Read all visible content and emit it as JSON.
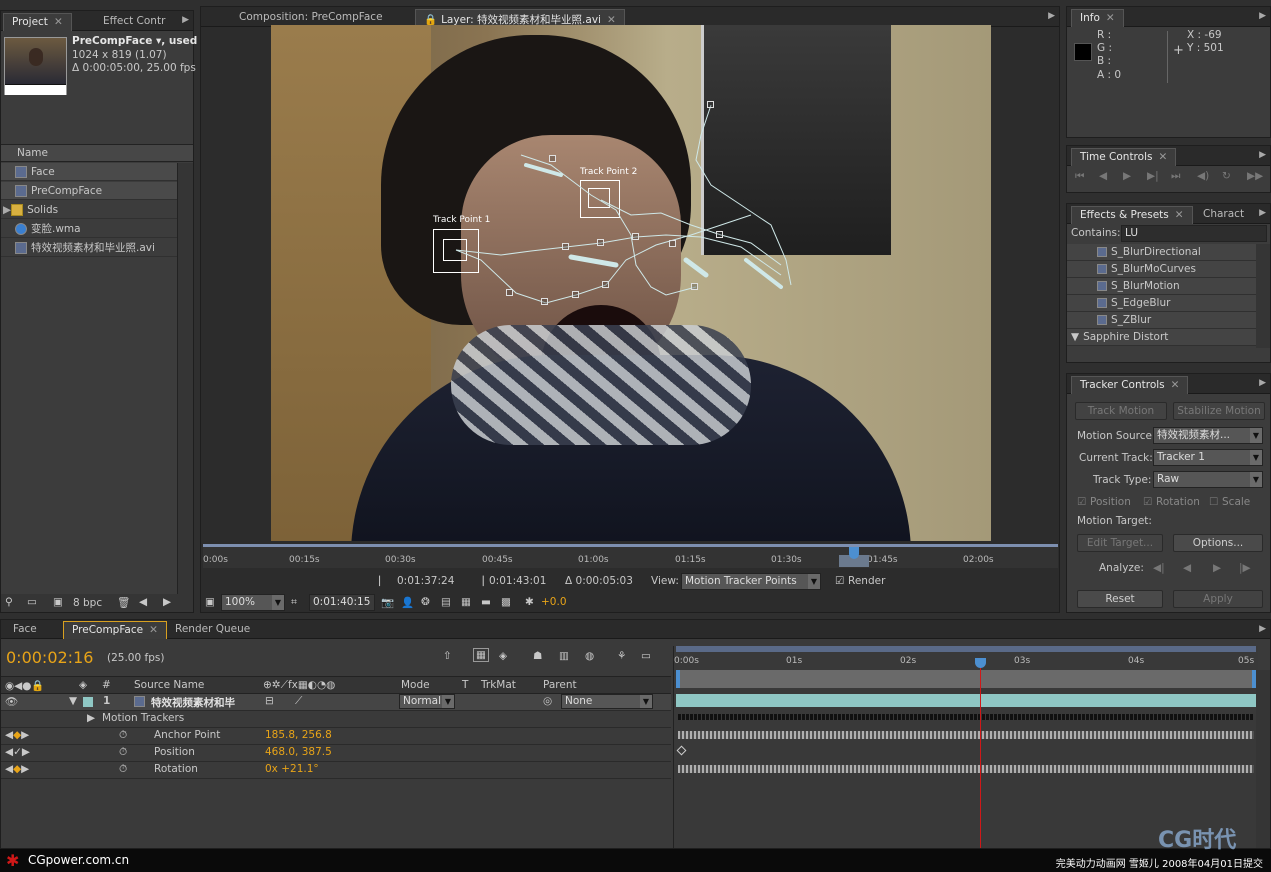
{
  "project": {
    "tab_project": "Project",
    "tab_effect": "Effect Contr",
    "comp_name": "PreCompFace ▾, used",
    "comp_size": "1024 x 819 (1.07)",
    "comp_dur": "Δ 0:00:05:00, 25.00 fps",
    "name_header": "Name",
    "items": [
      {
        "label": "Face"
      },
      {
        "label": "PreCompFace"
      },
      {
        "label": "Solids"
      },
      {
        "label": "变脸.wma"
      },
      {
        "label": "特效视频素材和毕业照.avi"
      }
    ],
    "bpc": "8 bpc"
  },
  "viewer": {
    "tab_comp": "Composition: PreCompFace",
    "tab_layer": "Layer: 特效视频素材和毕业照.avi",
    "track_point_1": "Track Point 1",
    "track_point_2": "Track Point 2",
    "ruler": [
      "0:00s",
      "00:15s",
      "00:30s",
      "00:45s",
      "01:00s",
      "01:15s",
      "01:30s",
      "01:45s",
      "02:00s"
    ],
    "in_time": "0:01:37:24",
    "out_time": "0:01:43:01",
    "dur_time": "Δ 0:00:05:03",
    "view_label": "View:",
    "view_value": "Motion Tracker Points",
    "render_label": "Render",
    "zoom": "100%",
    "current_time": "0:01:40:15",
    "exposure": "+0.0"
  },
  "info": {
    "tab": "Info",
    "r": "R :",
    "g": "G :",
    "b": "B :",
    "a": "A : 0",
    "x": "X : -69",
    "y": "Y : 501"
  },
  "time_controls": {
    "tab": "Time Controls"
  },
  "effects": {
    "tab": "Effects & Presets",
    "tab2": "Charact",
    "contains_label": "Contains:",
    "contains_value": "LU",
    "items": [
      "S_BlurDirectional",
      "S_BlurMoCurves",
      "S_BlurMotion",
      "S_EdgeBlur",
      "S_ZBlur"
    ],
    "group": "Sapphire Distort"
  },
  "tracker": {
    "tab": "Tracker Controls",
    "track_motion": "Track Motion",
    "stabilize_motion": "Stabilize Motion",
    "motion_source_label": "Motion Source:",
    "motion_source": "特效视频素材...",
    "current_track_label": "Current Track:",
    "current_track": "Tracker 1",
    "track_type_label": "Track Type:",
    "track_type": "Raw",
    "position": "Position",
    "rotation": "Rotation",
    "scale": "Scale",
    "motion_target_label": "Motion Target:",
    "edit_target": "Edit Target...",
    "options": "Options...",
    "analyze_label": "Analyze:",
    "reset": "Reset",
    "apply": "Apply"
  },
  "timeline": {
    "tab_face": "Face",
    "tab_precomp": "PreCompFace",
    "tab_render": "Render Queue",
    "time": "0:00:02:16",
    "fps": "(25.00 fps)",
    "col_num": "#",
    "col_source": "Source Name",
    "col_mode": "Mode",
    "col_t": "T",
    "col_trkmat": "TrkMat",
    "col_parent": "Parent",
    "layer_num": "1",
    "layer_name": "特效视频素材和毕",
    "layer_mode": "Normal",
    "layer_parent": "None",
    "motion_trackers": "Motion Trackers",
    "props": [
      {
        "name": "Anchor Point",
        "value": "185.8, 256.8"
      },
      {
        "name": "Position",
        "value": "468.0, 387.5"
      },
      {
        "name": "Rotation",
        "value": "0x +21.1°"
      }
    ],
    "ruler": [
      "0:00s",
      "01s",
      "02s",
      "03s",
      "04s",
      "05s"
    ]
  },
  "footer": {
    "left": "CGpower.com.cn",
    "right": "完美动力动画网 雪姬儿 2008年04月01日提交",
    "logo": "CG时代"
  },
  "colors": {
    "accent": "#e8a418",
    "layer_bar": "#8fc7c4",
    "cti": "#d01818"
  }
}
